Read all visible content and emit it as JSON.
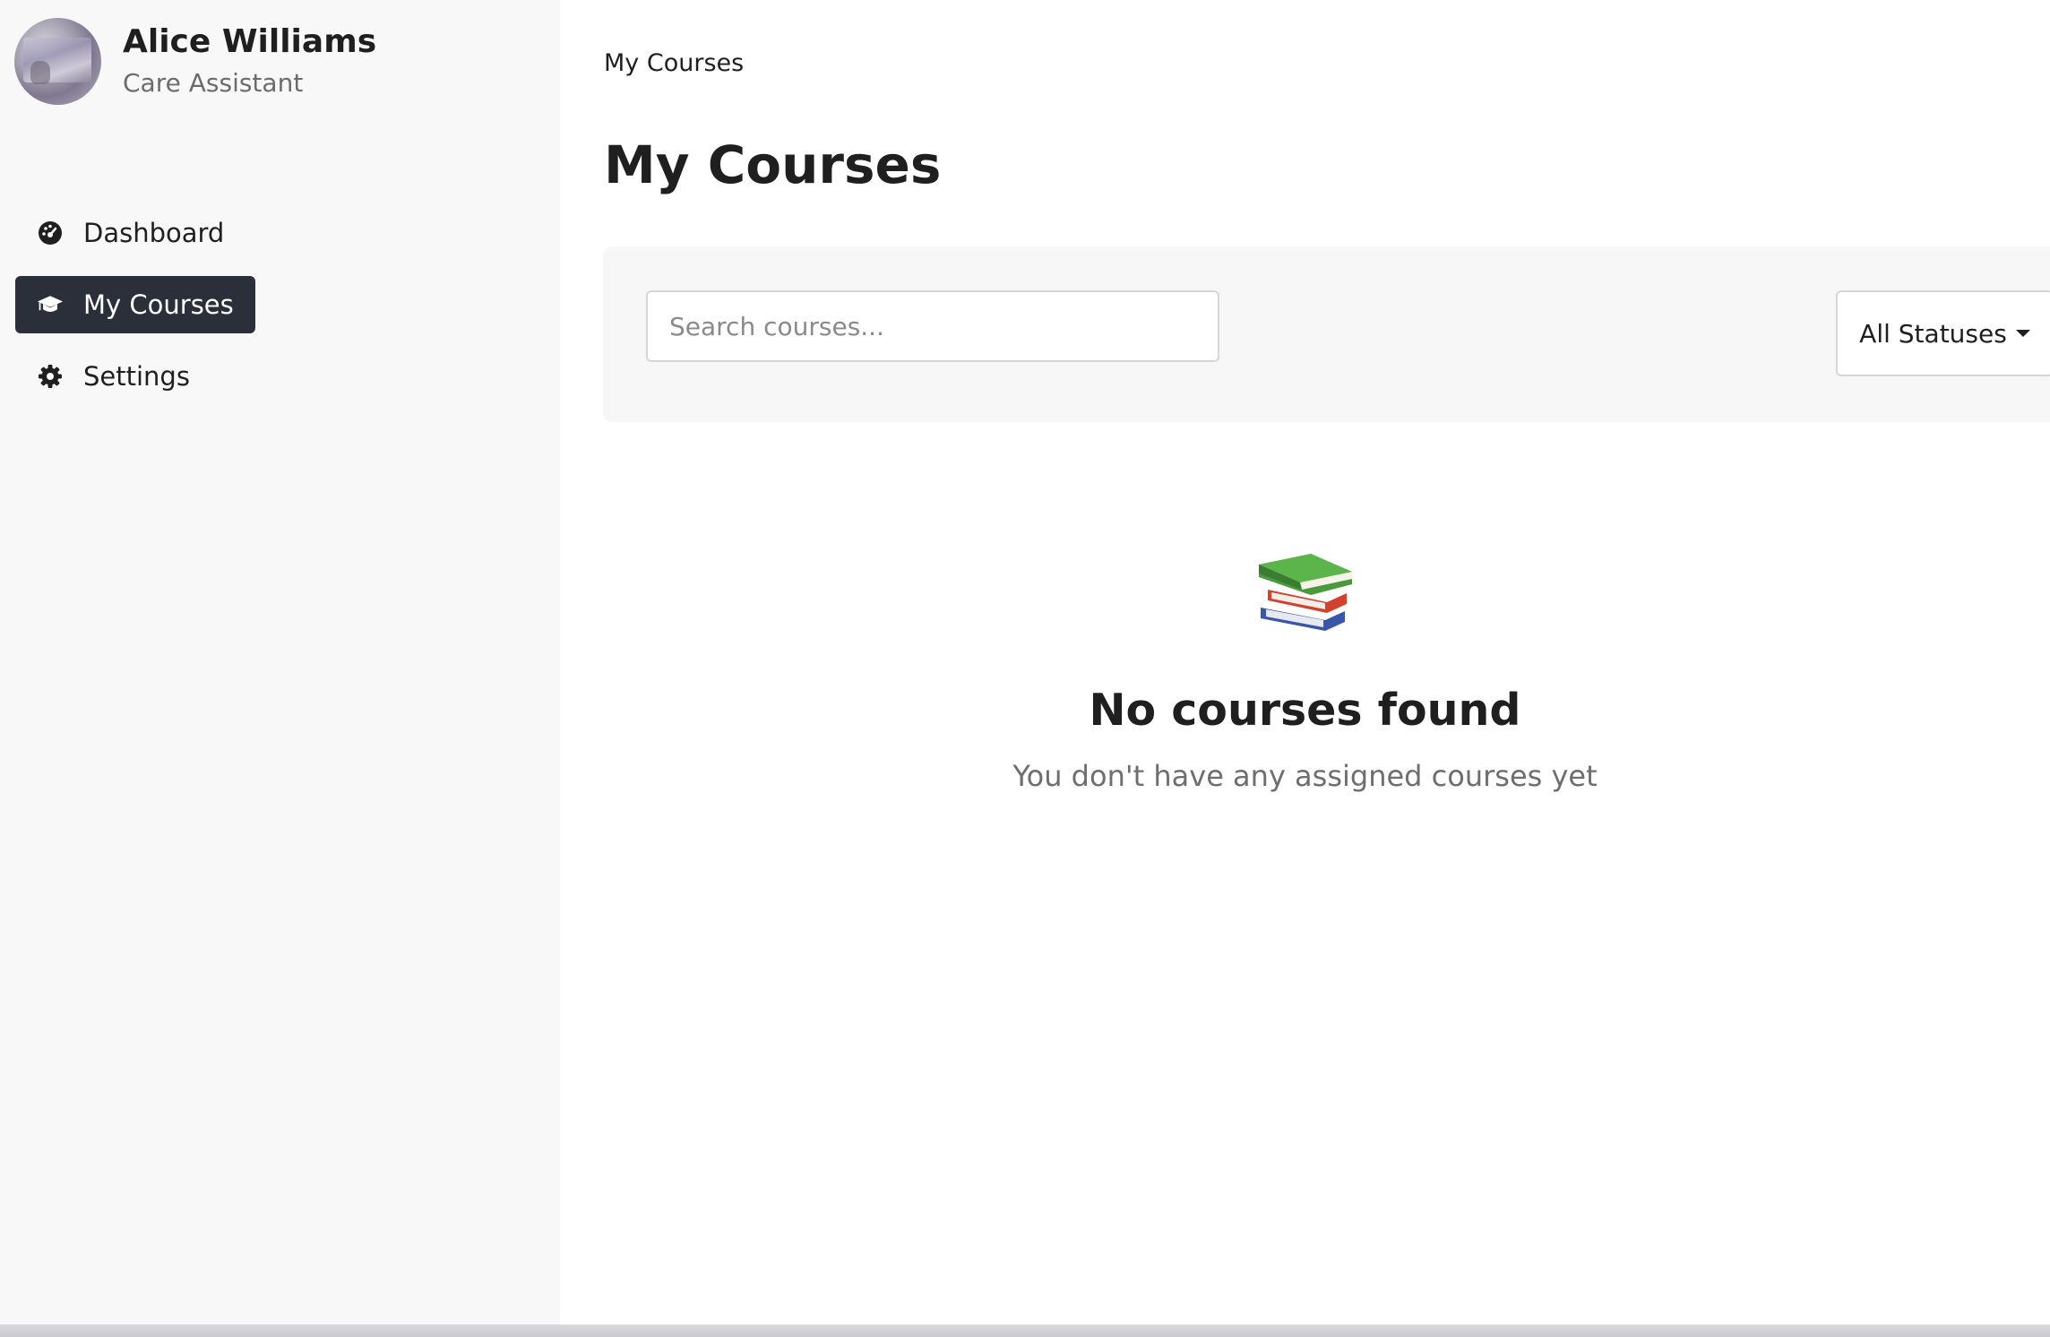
{
  "user": {
    "name": "Alice Williams",
    "role": "Care Assistant"
  },
  "sidebar": {
    "items": [
      {
        "label": "Dashboard",
        "icon": "dashboard-icon",
        "active": false
      },
      {
        "label": "My Courses",
        "icon": "graduation-cap-icon",
        "active": true
      },
      {
        "label": "Settings",
        "icon": "gear-icon",
        "active": false
      }
    ]
  },
  "breadcrumb": "My Courses",
  "page_title": "My Courses",
  "filters": {
    "search_placeholder": "Search courses...",
    "status_selected": "All Statuses"
  },
  "empty_state": {
    "icon": "books-icon",
    "title": "No courses found",
    "subtitle": "You don't have any assigned courses yet"
  },
  "colors": {
    "sidebar_bg": "#f8f8f8",
    "active_nav_bg": "#2b2f3a",
    "filter_bar_bg": "#f7f7f7"
  }
}
